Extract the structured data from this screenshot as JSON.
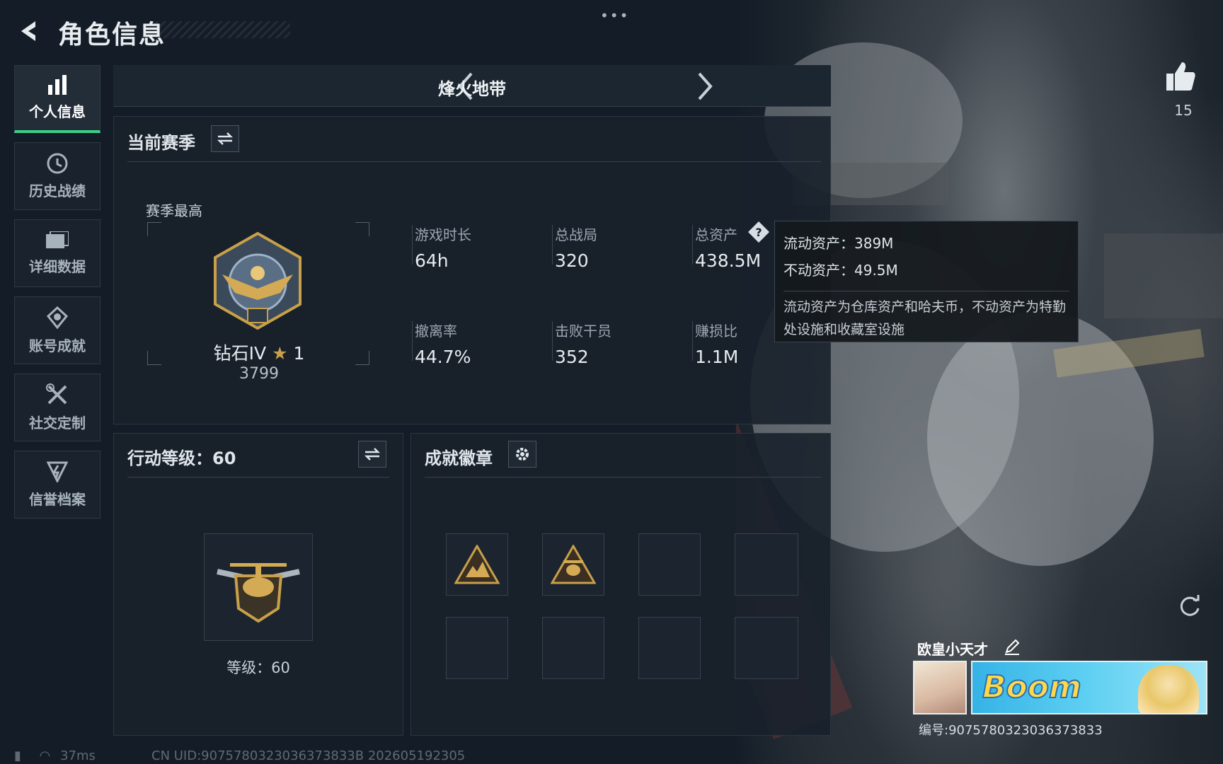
{
  "header": {
    "title": "角色信息"
  },
  "sidebar": {
    "items": [
      {
        "label": "个人信息",
        "icon": "bar-chart-icon",
        "active": true
      },
      {
        "label": "历史战绩",
        "icon": "clock-history-icon",
        "active": false
      },
      {
        "label": "详细数据",
        "icon": "folder-icon",
        "active": false
      },
      {
        "label": "账号成就",
        "icon": "medal-icon",
        "active": false
      },
      {
        "label": "社交定制",
        "icon": "tools-icon",
        "active": false
      },
      {
        "label": "信誉档案",
        "icon": "shield-lightning-icon",
        "active": false
      }
    ]
  },
  "mode": {
    "title": "烽火地带"
  },
  "season": {
    "title": "当前赛季",
    "best_label": "赛季最高",
    "rank_name": "钻石IV",
    "rank_stars": "1",
    "rank_points": "3799",
    "stats": [
      {
        "label": "游戏时长",
        "value": "64h"
      },
      {
        "label": "总战局",
        "value": "320"
      },
      {
        "label": "总资产",
        "value": "438.5M"
      },
      {
        "label": "撤离率",
        "value": "44.7%"
      },
      {
        "label": "击败干员",
        "value": "352"
      },
      {
        "label": "赚损比",
        "value": "1.1M"
      }
    ]
  },
  "tooltip": {
    "liquid": "流动资产：389M",
    "fixed": "不动资产：49.5M",
    "note": "流动资产为仓库资产和哈夫币，不动资产为特勤处设施和收藏室设施"
  },
  "action_level": {
    "title": "行动等级：60",
    "level_text": "等级：60"
  },
  "achievements": {
    "title": "成就徽章"
  },
  "likes": {
    "count": "15"
  },
  "player": {
    "name": "欧皇小天才",
    "id": "编号:9075780323036373833",
    "banner_text": "Boom"
  },
  "status": {
    "ping": "37ms",
    "uid": "CN UID:9075780323036373833B 202605192305"
  },
  "colors": {
    "accent": "#3ecf86",
    "gold": "#c9a04a",
    "panel": "#18212b"
  }
}
